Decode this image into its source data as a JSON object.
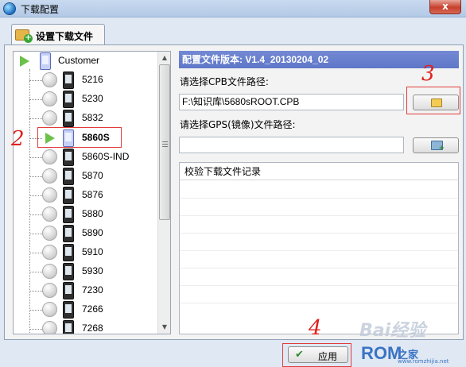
{
  "window": {
    "title": "下载配置",
    "close_label": "x"
  },
  "tab": {
    "label": "设置下载文件"
  },
  "tree": {
    "root": {
      "label": "Customer"
    },
    "items": [
      {
        "label": "5216",
        "selected": false
      },
      {
        "label": "5230",
        "selected": false
      },
      {
        "label": "5832",
        "selected": false
      },
      {
        "label": "5860S",
        "selected": true
      },
      {
        "label": "5860S-IND",
        "selected": false
      },
      {
        "label": "5870",
        "selected": false
      },
      {
        "label": "5876",
        "selected": false
      },
      {
        "label": "5880",
        "selected": false
      },
      {
        "label": "5890",
        "selected": false
      },
      {
        "label": "5910",
        "selected": false
      },
      {
        "label": "5930",
        "selected": false
      },
      {
        "label": "7230",
        "selected": false
      },
      {
        "label": "7266",
        "selected": false
      },
      {
        "label": "7268",
        "selected": false
      }
    ]
  },
  "config": {
    "version_label": "配置文件版本: V1.4_20130204_02",
    "cpb_label": "请选择CPB文件路径:",
    "cpb_value": "F:\\知识库\\5680sROOT.CPB",
    "gps_label": "请选择GPS(镜像)文件路径:",
    "gps_value": "",
    "log_header": "校验下载文件记录"
  },
  "apply_label": "应用",
  "annotations": {
    "n2": "2",
    "n3": "3",
    "n4": "4"
  },
  "watermark": {
    "baidu": "Bai经验",
    "rom": "ROM",
    "romzh": "之家",
    "url": "www.romzhijia.net"
  },
  "colors": {
    "version_bar": "#6a80cf",
    "annotation_red": "#e02020"
  }
}
